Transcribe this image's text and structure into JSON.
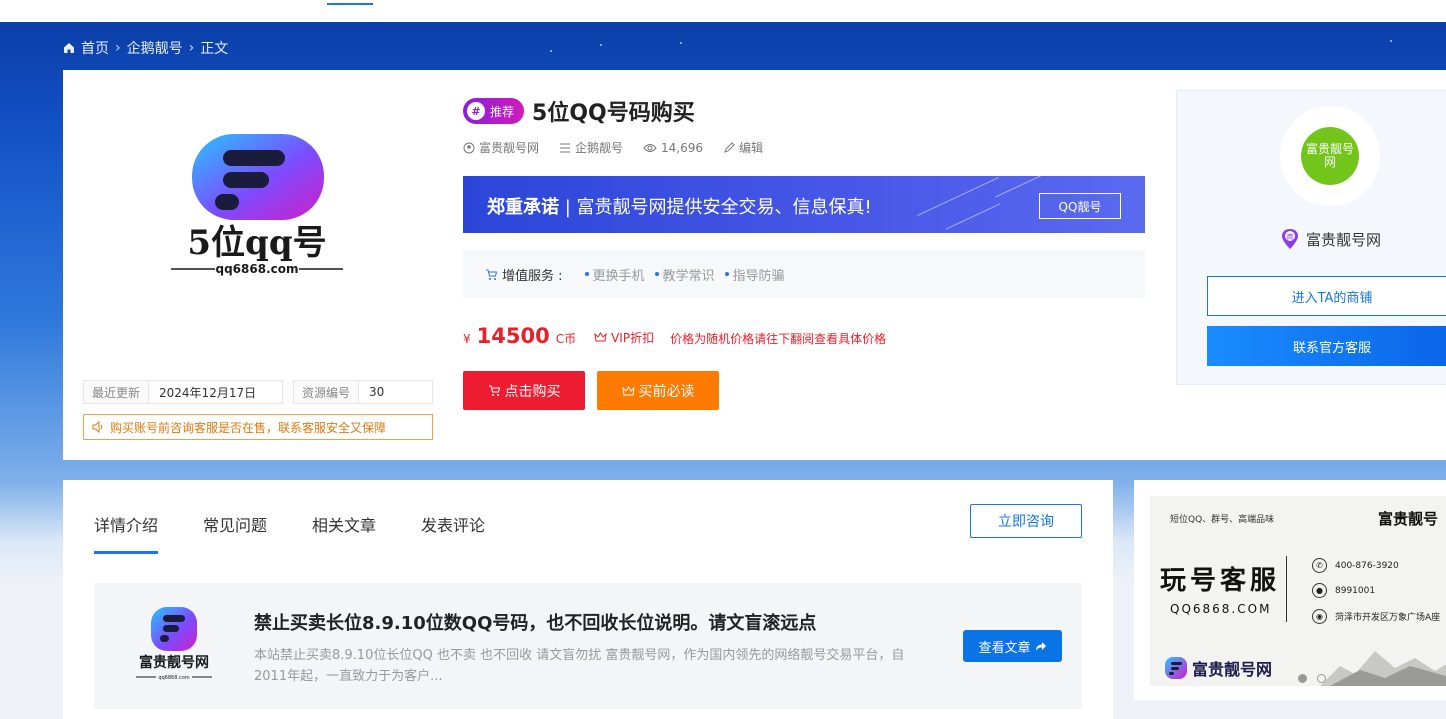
{
  "breadcrumb": {
    "home": "首页",
    "category": "企鹅靓号",
    "current": "正文"
  },
  "product": {
    "logo_text": "5位qq号",
    "logo_domain": "qq6868.com",
    "badge": "推荐",
    "badge_hash": "#",
    "title": "5位QQ号码购买",
    "author": "富贵靓号网",
    "category": "企鹅靓号",
    "views": "14,696",
    "edit": "编辑"
  },
  "banner": {
    "bold": "郑重承诺",
    "text": "富贵靓号网提供安全交易、信息保真!",
    "tag": "QQ靓号"
  },
  "services": {
    "label": "增值服务 :",
    "items": [
      "更换手机",
      "教学常识",
      "指导防骗"
    ]
  },
  "price": {
    "currency": "¥",
    "value": "14500",
    "unit": "C币",
    "vip": "VIP折扣",
    "note": "价格为随机价格请往下翻阅查看具体价格"
  },
  "buttons": {
    "buy": "点击购买",
    "read": "买前必读"
  },
  "meta": {
    "updated_label": "最近更新",
    "updated_value": "2024年12月17日",
    "id_label": "资源编号",
    "id_value": "30"
  },
  "notice": "购买账号前咨询客服是否在售，联系客服安全又保障",
  "shop": {
    "avatar_text": "富贵靓号网",
    "name": "富贵靓号网",
    "shop_badge": "商",
    "enter": "进入TA的商铺",
    "contact": "联系官方客服"
  },
  "tabs": [
    "详情介绍",
    "常见问题",
    "相关文章",
    "发表评论"
  ],
  "consult": "立即咨询",
  "article": {
    "logo_name": "富贵靓号网",
    "logo_domain": "qq6868.com",
    "title": "禁止买卖长位8.9.10位数QQ号码，也不回收长位说明。请文盲滚远点",
    "desc": "本站禁止买卖8.9.10位长位QQ 也不卖 也不回收 请文盲勿扰 富贵靓号网，作为国内领先的网络靓号交易平台，自2011年起，一直致力于为客户...",
    "button": "查看文章"
  },
  "ad": {
    "tagline": "短位QQ、群号、高端品味",
    "brand_cn": "富贵靓号",
    "big": "玩号客服",
    "domain": "QQ6868.COM",
    "phone": "400-876-3920",
    "qq": "8991001",
    "address": "菏泽市开发区万象广场A座",
    "brand": "富贵靓号网"
  },
  "colors": {
    "accent": "#1677e5",
    "price": "#e6212a",
    "buy": "#ee1c30",
    "read": "#ff7a00"
  }
}
